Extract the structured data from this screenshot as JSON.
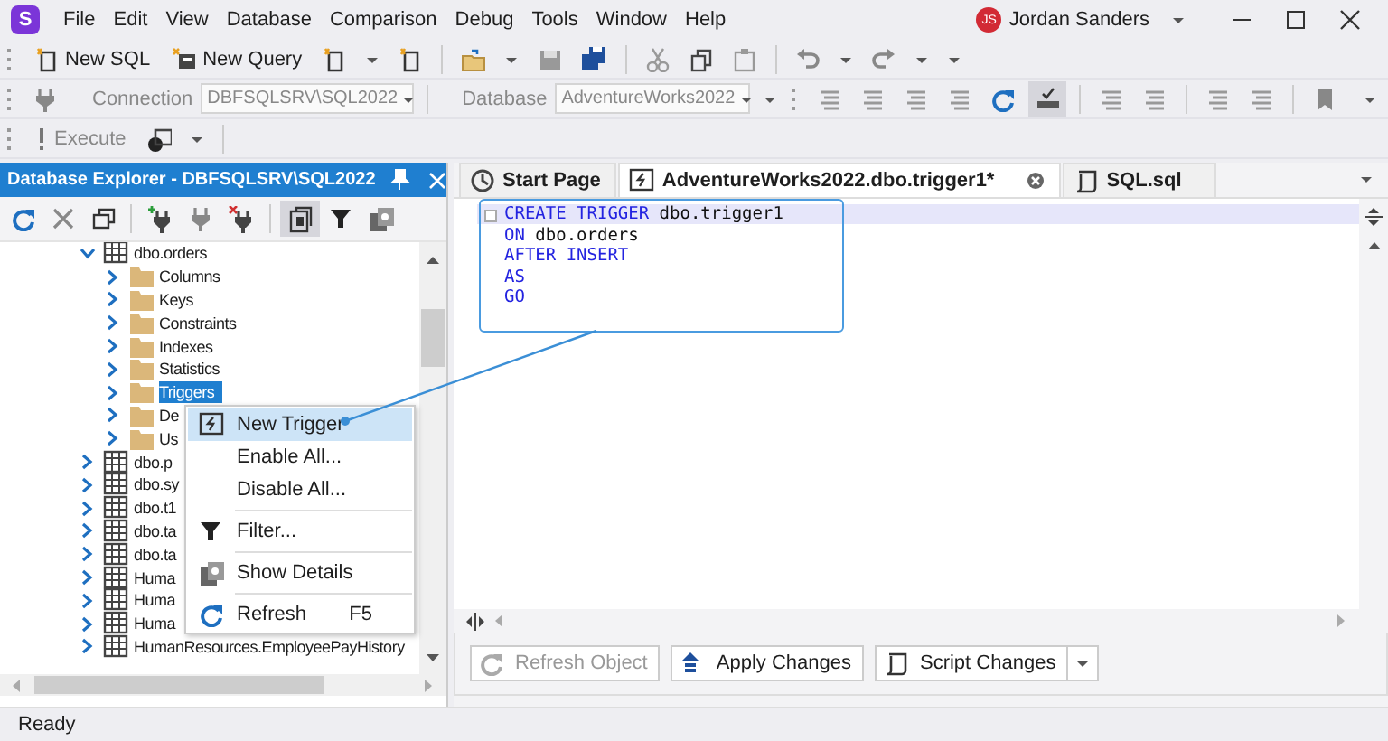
{
  "app": {
    "logo": "S"
  },
  "menu": [
    "File",
    "Edit",
    "View",
    "Database",
    "Comparison",
    "Debug",
    "Tools",
    "Window",
    "Help"
  ],
  "user": {
    "initials": "JS",
    "name": "Jordan Sanders"
  },
  "toolbar": {
    "new_sql": "New SQL",
    "new_query": "New Query",
    "connection_label": "Connection",
    "connection_value": "DBFSQLSRV\\SQL2022",
    "database_label": "Database",
    "database_value": "AdventureWorks2022",
    "execute": "Execute",
    "execute_disabled": true,
    "sql_check_pressed": true
  },
  "explorer": {
    "title": "Database Explorer - DBFSQLSRV\\SQL2022",
    "tree": [
      {
        "label": "dbo.orders",
        "kind": "table",
        "expanded": true,
        "selected": false,
        "children": [
          {
            "label": "Columns",
            "kind": "folder",
            "expanded": false,
            "selected": false
          },
          {
            "label": "Keys",
            "kind": "folder",
            "expanded": false,
            "selected": false
          },
          {
            "label": "Constraints",
            "kind": "folder",
            "expanded": false,
            "selected": false
          },
          {
            "label": "Indexes",
            "kind": "folder",
            "expanded": false,
            "selected": false
          },
          {
            "label": "Statistics",
            "kind": "folder",
            "expanded": false,
            "selected": false
          },
          {
            "label": "Triggers",
            "kind": "folder",
            "expanded": false,
            "selected": true
          },
          {
            "label": "De",
            "kind": "folder",
            "expanded": false,
            "selected": false
          },
          {
            "label": "Us",
            "kind": "folder",
            "expanded": false,
            "selected": false
          }
        ]
      },
      {
        "label": "dbo.p",
        "kind": "table",
        "expanded": false,
        "selected": false
      },
      {
        "label": "dbo.sy",
        "kind": "table",
        "expanded": false,
        "selected": false
      },
      {
        "label": "dbo.t1",
        "kind": "table",
        "expanded": false,
        "selected": false
      },
      {
        "label": "dbo.ta",
        "kind": "table",
        "expanded": false,
        "selected": false
      },
      {
        "label": "dbo.ta",
        "kind": "table",
        "expanded": false,
        "selected": false
      },
      {
        "label": "Huma",
        "kind": "table",
        "expanded": false,
        "selected": false
      },
      {
        "label": "Huma",
        "kind": "table",
        "expanded": false,
        "selected": false
      },
      {
        "label": "Huma",
        "kind": "table",
        "expanded": false,
        "selected": false
      },
      {
        "label": "HumanResources.EmployeePayHistory",
        "kind": "table",
        "expanded": false,
        "selected": false
      }
    ]
  },
  "context_menu": [
    {
      "label": "New Trigger",
      "kind": "new",
      "selected": true,
      "separator_before": false
    },
    {
      "label": "Enable All...",
      "kind": "none",
      "selected": false,
      "separator_before": false
    },
    {
      "label": "Disable All...",
      "kind": "none",
      "selected": false,
      "separator_before": false
    },
    {
      "label": "Filter...",
      "kind": "filter",
      "selected": false,
      "separator_before": true
    },
    {
      "label": "Show Details",
      "kind": "details",
      "selected": false,
      "separator_before": true
    },
    {
      "label": "Refresh",
      "kind": "refresh",
      "shortcut": "F5",
      "selected": false,
      "separator_before": true
    }
  ],
  "tabs": [
    {
      "label": "Start Page",
      "kind": "start",
      "selected": false,
      "closable": false
    },
    {
      "label": "AdventureWorks2022.dbo.trigger1*",
      "kind": "trigger",
      "selected": true,
      "closable": true
    },
    {
      "label": "SQL.sql",
      "kind": "script",
      "selected": false,
      "closable": false
    }
  ],
  "code": [
    [
      {
        "text": "CREATE TRIGGER",
        "kind": "keyword"
      },
      {
        "text": " dbo.trigger1",
        "kind": "plain"
      }
    ],
    [
      {
        "text": "ON",
        "kind": "keyword"
      },
      {
        "text": " dbo.orders",
        "kind": "plain"
      }
    ],
    [
      {
        "text": "AFTER INSERT",
        "kind": "keyword"
      }
    ],
    [
      {
        "text": "AS",
        "kind": "keyword"
      }
    ],
    [
      {
        "text": "GO",
        "kind": "keyword"
      }
    ]
  ],
  "buttons": [
    {
      "label": "Refresh Object",
      "kind": "refresh",
      "disabled": true,
      "dropdown": false
    },
    {
      "label": "Apply Changes",
      "kind": "apply",
      "disabled": false,
      "dropdown": false
    },
    {
      "label": "Script Changes",
      "kind": "script",
      "disabled": false,
      "dropdown": true
    }
  ],
  "status_bar": "Ready"
}
